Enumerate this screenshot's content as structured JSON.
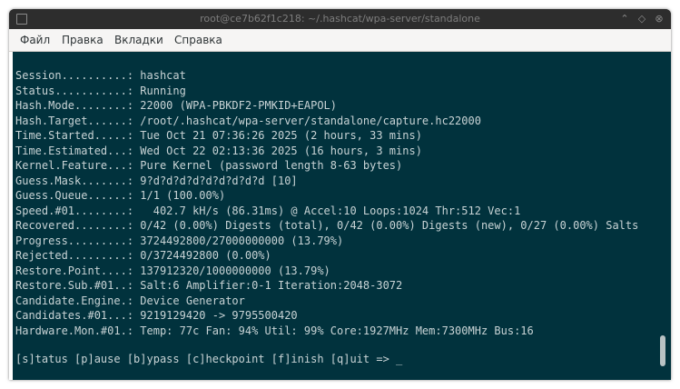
{
  "window": {
    "title": "root@ce7b62f1c218: ~/.hashcat/wpa-server/standalone",
    "minimize_glyph": "⌃",
    "maximize_glyph": "◇",
    "close_glyph": "⊗"
  },
  "menu": {
    "items": [
      "Файл",
      "Правка",
      "Вкладки",
      "Справка"
    ]
  },
  "terminal": {
    "lines": [
      "Session..........: hashcat",
      "Status...........: Running",
      "Hash.Mode........: 22000 (WPA-PBKDF2-PMKID+EAPOL)",
      "Hash.Target......: /root/.hashcat/wpa-server/standalone/capture.hc22000",
      "Time.Started.....: Tue Oct 21 07:36:26 2025 (2 hours, 33 mins)",
      "Time.Estimated...: Wed Oct 22 02:13:36 2025 (16 hours, 3 mins)",
      "Kernel.Feature...: Pure Kernel (password length 8-63 bytes)",
      "Guess.Mask.......: 9?d?d?d?d?d?d?d?d?d [10]",
      "Guess.Queue......: 1/1 (100.00%)",
      "Speed.#01........:   402.7 kH/s (86.31ms) @ Accel:10 Loops:1024 Thr:512 Vec:1",
      "Recovered........: 0/42 (0.00%) Digests (total), 0/42 (0.00%) Digests (new), 0/27 (0.00%) Salts",
      "Progress.........: 3724492800/27000000000 (13.79%)",
      "Rejected.........: 0/3724492800 (0.00%)",
      "Restore.Point....: 137912320/1000000000 (13.79%)",
      "Restore.Sub.#01..: Salt:6 Amplifier:0-1 Iteration:2048-3072",
      "Candidate.Engine.: Device Generator",
      "Candidates.#01...: 9219129420 -> 9795500420",
      "Hardware.Mon.#01.: Temp: 77c Fan: 94% Util: 99% Core:1927MHz Mem:7300MHz Bus:16"
    ],
    "prompt": "[s]tatus [p]ause [b]ypass [c]heckpoint [f]inish [q]uit => _"
  },
  "colors": {
    "terminal_background": "#01323d",
    "terminal_text": "#c8d3d5",
    "titlebar": "#2d2d2d",
    "menubar": "#f6f5f4"
  },
  "scrollbar": {
    "position_fraction": 0.98
  }
}
